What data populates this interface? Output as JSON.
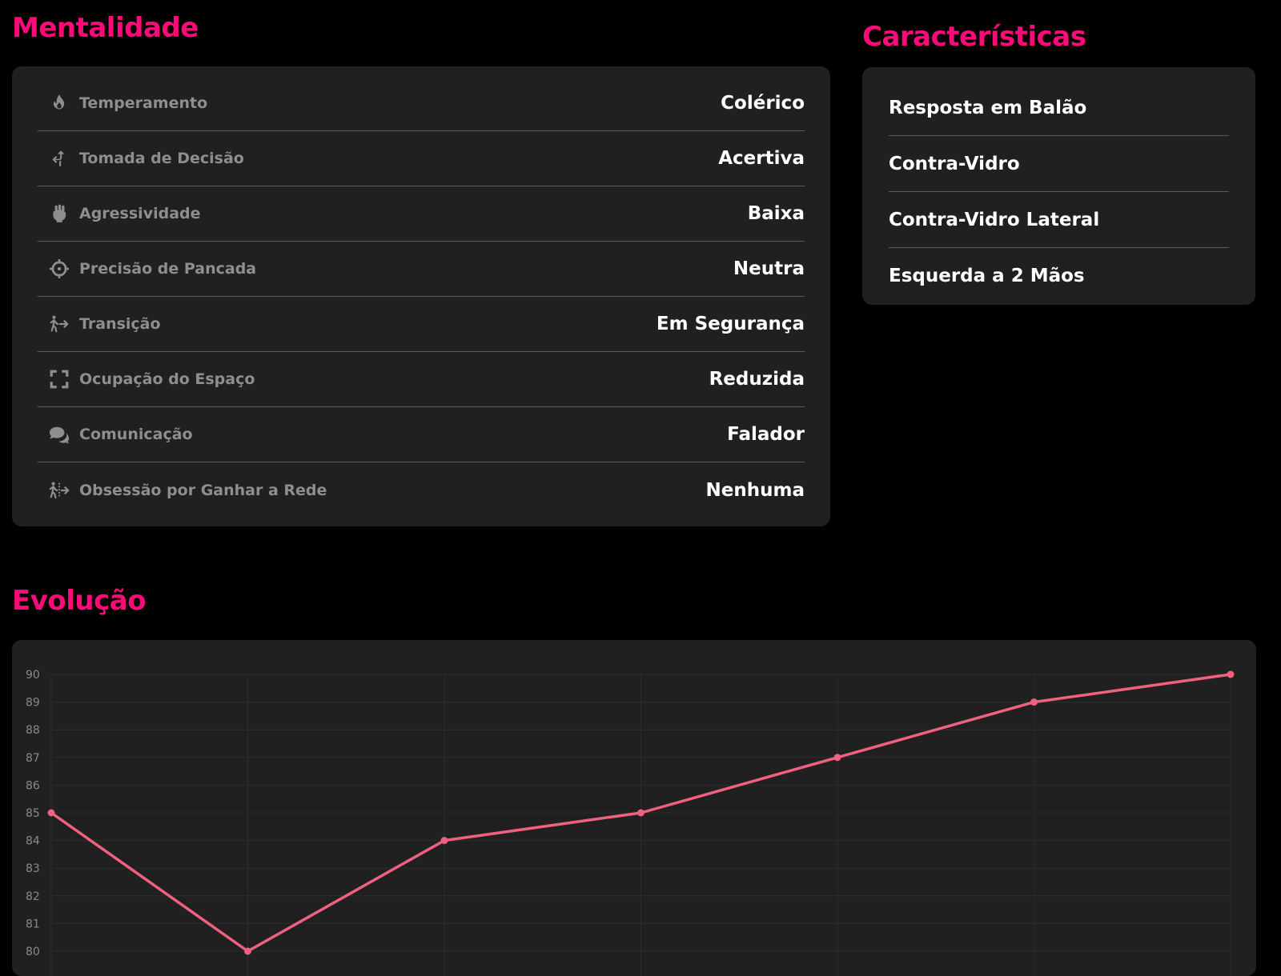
{
  "mentalidade": {
    "title": "Mentalidade",
    "rows": [
      {
        "icon": "fire-icon",
        "label": "Temperamento",
        "value": "Colérico"
      },
      {
        "icon": "split-arrow-icon",
        "label": "Tomada de Decisão",
        "value": "Acertiva"
      },
      {
        "icon": "fist-icon",
        "label": "Agressividade",
        "value": "Baixa"
      },
      {
        "icon": "crosshairs-icon",
        "label": "Precisão de Pancada",
        "value": "Neutra"
      },
      {
        "icon": "person-walking-arrow-icon",
        "label": "Transição",
        "value": "Em Segurança"
      },
      {
        "icon": "expand-icon",
        "label": "Ocupação do Espaço",
        "value": "Reduzida"
      },
      {
        "icon": "comments-icon",
        "label": "Comunicação",
        "value": "Falador"
      },
      {
        "icon": "person-walking-dashed-arrow-icon",
        "label": "Obsessão por Ganhar a Rede",
        "value": "Nenhuma"
      }
    ]
  },
  "caracteristicas": {
    "title": "Características",
    "items": [
      "Resposta em Balão",
      "Contra-Vidro",
      "Contra-Vidro Lateral",
      "Esquerda a 2 Mãos"
    ]
  },
  "evolucao": {
    "title": "Evolução"
  },
  "colors": {
    "accent": "#ff0a78",
    "line": "#f0607f",
    "panel": "#202020"
  },
  "chart_data": {
    "type": "line",
    "x": [
      1,
      2,
      3,
      4,
      5,
      6,
      7
    ],
    "series": [
      {
        "values": [
          85,
          80,
          84,
          85,
          87,
          89,
          90
        ]
      }
    ],
    "y_ticks": [
      80,
      81,
      82,
      83,
      84,
      85,
      86,
      87,
      88,
      89,
      90
    ],
    "ylim": [
      80,
      90
    ],
    "grid": true
  }
}
